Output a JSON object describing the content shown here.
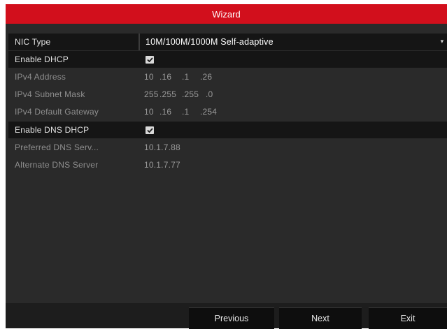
{
  "window": {
    "title": "Wizard"
  },
  "form": {
    "nic_type": {
      "label": "NIC Type",
      "value": "10M/100M/1000M Self-adaptive",
      "icon": "chevron-down-icon"
    },
    "enable_dhcp": {
      "label": "Enable DHCP",
      "checked": true
    },
    "ipv4_address": {
      "label": "IPv4 Address",
      "octets": [
        "10",
        ".16",
        ".1",
        ".26"
      ]
    },
    "ipv4_subnet_mask": {
      "label": "IPv4 Subnet Mask",
      "octets": [
        "255",
        ".255",
        ".255",
        ".0"
      ]
    },
    "ipv4_default_gateway": {
      "label": "IPv4 Default Gateway",
      "octets": [
        "10",
        ".16",
        ".1",
        ".254"
      ]
    },
    "enable_dns_dhcp": {
      "label": "Enable DNS DHCP",
      "checked": true
    },
    "preferred_dns": {
      "label": "Preferred DNS Serv...",
      "value": "10.1.7.88"
    },
    "alternate_dns": {
      "label": "Alternate DNS Server",
      "value": "10.1.7.77"
    }
  },
  "footer": {
    "previous_label": "Previous",
    "next_label": "Next",
    "exit_label": "Exit"
  },
  "colors": {
    "titlebar": "#d20f1c",
    "panel": "#2a2a2a",
    "row_highlight": "#151515",
    "button": "#0e0e0e"
  }
}
